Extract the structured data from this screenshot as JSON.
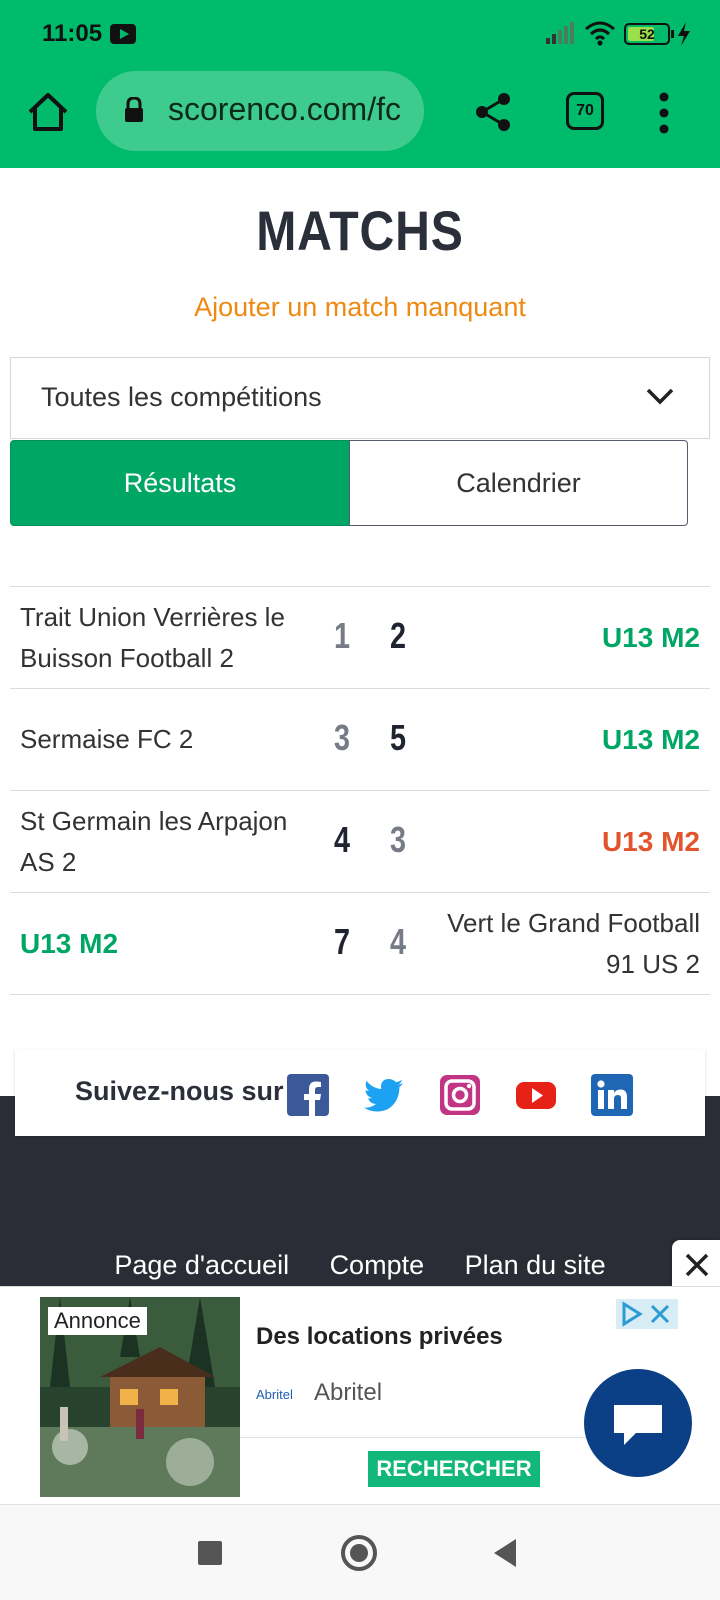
{
  "status_bar": {
    "time": "11:05",
    "battery": "52",
    "icons": [
      "youtube-icon",
      "signal-icon",
      "wifi-icon",
      "battery-icon",
      "charging-icon"
    ]
  },
  "browser": {
    "url": "scorenco.com/fc",
    "tab_count": "70",
    "icons": [
      "home-icon",
      "lock-icon",
      "share-icon",
      "tabs-icon",
      "more-vert-icon"
    ]
  },
  "page": {
    "title": "MATCHS",
    "add_link": "Ajouter un match manquant",
    "competition_select": "Toutes les compétitions",
    "tabs": [
      "Résultats",
      "Calendrier"
    ]
  },
  "matches": [
    {
      "left": "Trait Union Verrières le Buisson Football 2",
      "score_left": "1",
      "score_right": "2",
      "right": "U13 M2"
    },
    {
      "left": "Sermaise FC 2",
      "score_left": "3",
      "score_right": "5",
      "right": "U13 M2"
    },
    {
      "left": "St Germain les Arpajon AS 2",
      "score_left": "4",
      "score_right": "3",
      "right": "U13 M2"
    },
    {
      "left": "U13 M2",
      "score_left": "7",
      "score_right": "4",
      "right": "Vert le Grand Football 91 US 2"
    }
  ],
  "footer": {
    "follow_label": "Suivez-nous sur",
    "social": [
      "facebook-icon",
      "twitter-icon",
      "instagram-icon",
      "youtube-icon",
      "linkedin-icon"
    ],
    "links": [
      "Page d'accueil",
      "Compte",
      "Plan du site"
    ]
  },
  "ad": {
    "tag": "Annonce",
    "title": "Des locations privées",
    "brand_logo": "Abritel",
    "brand": "Abritel",
    "cta": "RECHERCHER"
  },
  "colors": {
    "brand_green": "#00bb6b",
    "tab_green": "#00a764",
    "link_orange": "#ee8a12",
    "win_green": "#00a764",
    "loss_red": "#e2542b",
    "footer_dark": "#2a2d35"
  }
}
